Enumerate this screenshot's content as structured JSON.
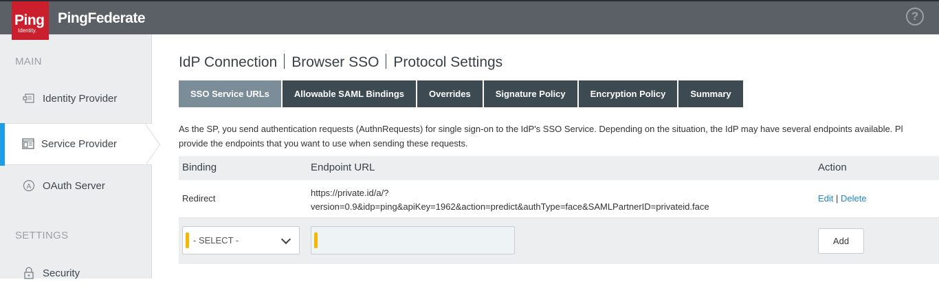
{
  "header": {
    "logo_main": "Ping",
    "logo_sub": "Identity.",
    "product": "PingFederate",
    "help_label": "?"
  },
  "sidebar": {
    "main_title": "MAIN",
    "settings_title": "SETTINGS",
    "items": [
      {
        "label": "Identity Provider",
        "icon": "identity-provider-icon"
      },
      {
        "label": "Service Provider",
        "icon": "service-provider-icon",
        "active": true
      },
      {
        "label": "OAuth Server",
        "icon": "oauth-icon"
      },
      {
        "label": "Security",
        "icon": "lock-icon"
      }
    ]
  },
  "breadcrumb": [
    "IdP Connection",
    "Browser SSO",
    "Protocol Settings"
  ],
  "tabs": [
    {
      "label": "SSO Service URLs",
      "active": true
    },
    {
      "label": "Allowable SAML Bindings"
    },
    {
      "label": "Overrides"
    },
    {
      "label": "Signature Policy"
    },
    {
      "label": "Encryption Policy"
    },
    {
      "label": "Summary"
    }
  ],
  "description": {
    "line1": "As the SP, you send authentication requests (AuthnRequests) for single sign-on to the IdP's SSO Service. Depending on the situation, the IdP may have several endpoints available. Pl",
    "line2": "provide the endpoints that you want to use when sending these requests."
  },
  "table": {
    "columns": [
      "Binding",
      "Endpoint URL",
      "Action"
    ],
    "rows": [
      {
        "binding": "Redirect",
        "url_line1": "https://private.id/a/?",
        "url_line2": "version=0.9&idp=ping&apiKey=1962&action=predict&authType=face&SAMLPartnerID=privateid.face",
        "edit": "Edit",
        "separator": "|",
        "delete": "Delete"
      }
    ],
    "new_row": {
      "select_value": "- SELECT -",
      "url_value": "",
      "add_label": "Add"
    }
  },
  "colors": {
    "accent": "#1c9de6",
    "logo": "#cc1f2e",
    "tab_bg": "#3e4a52",
    "tab_active": "#7c8d9a",
    "required": "#f5b800"
  }
}
